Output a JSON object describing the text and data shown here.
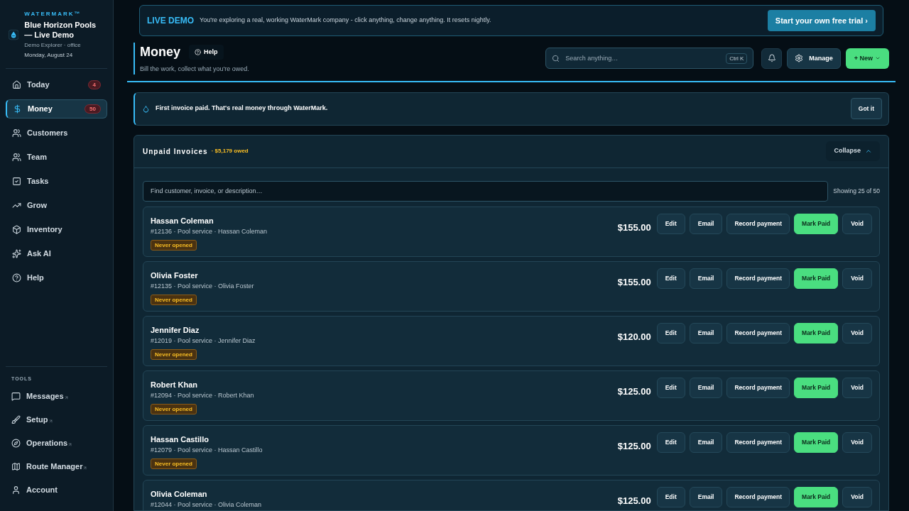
{
  "brand": {
    "name": "WATERMARK™",
    "company": "Blue Horizon Pools — Live Demo",
    "user": "Demo Explorer · office",
    "date": "Monday, August 24"
  },
  "nav": [
    {
      "label": "Today",
      "badge": "4",
      "selected": false
    },
    {
      "label": "Money",
      "badge": "50",
      "selected": true
    },
    {
      "label": "Customers",
      "selected": false
    },
    {
      "label": "Team",
      "selected": false
    },
    {
      "label": "Tasks",
      "selected": false
    },
    {
      "label": "Grow",
      "selected": false
    },
    {
      "label": "Inventory",
      "selected": false
    },
    {
      "label": "Ask AI",
      "selected": false
    },
    {
      "label": "Help",
      "selected": false
    }
  ],
  "tools": {
    "heading": "TOOLS",
    "items": [
      {
        "label": "Messages",
        "external": true
      },
      {
        "label": "Setup",
        "external": true
      },
      {
        "label": "Operations",
        "external": true
      },
      {
        "label": "Route Manager",
        "external": true
      },
      {
        "label": "Account",
        "external": false
      }
    ]
  },
  "demo_banner": {
    "tag": "LIVE DEMO",
    "text": "You're exploring a real, working WaterMark company - click anything, change anything. It resets nightly.",
    "button": "Start your own free trial ›"
  },
  "header": {
    "title": "Money",
    "help": "Help",
    "subtitle": "Bill the work, collect what you're owed.",
    "search": {
      "placeholder": "Search anything…",
      "shortcut": "Ctrl K"
    },
    "manage": "Manage",
    "new": "+ New"
  },
  "alert": {
    "text": "First invoice paid. That's real money through WaterMark.",
    "button": "Got it"
  },
  "invoices": {
    "title": "Unpaid Invoices",
    "owed": "· $5,179 owed",
    "collapse": "Collapse",
    "filter": {
      "placeholder": "Find customer, invoice, or description…"
    },
    "count": "Showing 25 of 50",
    "rows": [
      {
        "name": "Hassan Coleman",
        "detail": "#12136 · Pool service · Hassan Coleman",
        "badge": "Never opened",
        "amount": "$155.00",
        "actions": [
          "Edit",
          "Email",
          "Record payment",
          "Mark Paid",
          "Void"
        ]
      },
      {
        "name": "Olivia Foster",
        "detail": "#12135 · Pool service · Olivia Foster",
        "badge": "Never opened",
        "amount": "$155.00",
        "actions": [
          "Edit",
          "Email",
          "Record payment",
          "Mark Paid",
          "Void"
        ]
      },
      {
        "name": "Jennifer Diaz",
        "detail": "#12019 · Pool service · Jennifer Diaz",
        "badge": "Never opened",
        "amount": "$120.00",
        "actions": [
          "Edit",
          "Email",
          "Record payment",
          "Mark Paid",
          "Void"
        ]
      },
      {
        "name": "Robert Khan",
        "detail": "#12094 · Pool service · Robert Khan",
        "badge": "Never opened",
        "amount": "$125.00",
        "actions": [
          "Edit",
          "Email",
          "Record payment",
          "Mark Paid",
          "Void"
        ]
      },
      {
        "name": "Hassan Castillo",
        "detail": "#12079 · Pool service · Hassan Castillo",
        "badge": "Never opened",
        "amount": "$125.00",
        "actions": [
          "Edit",
          "Email",
          "Record payment",
          "Mark Paid",
          "Void"
        ]
      },
      {
        "name": "Olivia Coleman",
        "detail": "#12044 · Pool service · Olivia Coleman",
        "amount": "$125.00",
        "actions": [
          "Edit",
          "Email",
          "Record payment",
          "Mark Paid",
          "Void"
        ]
      }
    ]
  }
}
